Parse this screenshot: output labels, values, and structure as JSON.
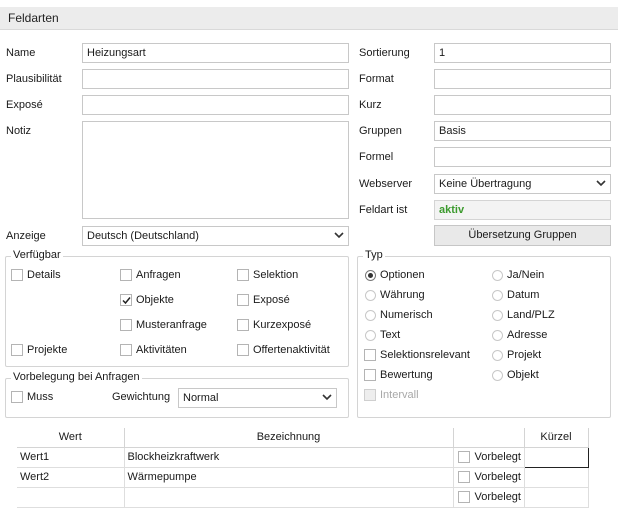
{
  "window": {
    "title": "Feldarten"
  },
  "left_fields": {
    "name": {
      "label": "Name",
      "value": "Heizungsart"
    },
    "plausibilitaet": {
      "label": "Plausibilität",
      "value": ""
    },
    "expose": {
      "label": "Exposé",
      "value": ""
    },
    "notiz": {
      "label": "Notiz",
      "value": ""
    },
    "anzeige": {
      "label": "Anzeige",
      "value": "Deutsch (Deutschland)"
    }
  },
  "right_fields": {
    "sortierung": {
      "label": "Sortierung",
      "value": "1"
    },
    "format": {
      "label": "Format",
      "value": ""
    },
    "kurz": {
      "label": "Kurz",
      "value": ""
    },
    "gruppen": {
      "label": "Gruppen",
      "value": "Basis"
    },
    "formel": {
      "label": "Formel",
      "value": ""
    },
    "webserver": {
      "label": "Webserver",
      "value": "Keine Übertragung"
    },
    "feldart_ist": {
      "label": "Feldart ist",
      "value": "aktiv"
    },
    "translate_button": "Übersetzung Gruppen"
  },
  "verfuegbar": {
    "title": "Verfügbar",
    "items": [
      {
        "label": "Details",
        "checked": false
      },
      {
        "label": "Anfragen",
        "checked": false
      },
      {
        "label": "Selektion",
        "checked": false
      },
      {
        "label": "Objekte",
        "checked": true
      },
      {
        "label": "Exposé",
        "checked": false
      },
      {
        "label": "Musteranfrage",
        "checked": false
      },
      {
        "label": "Kurzexposé",
        "checked": false
      },
      {
        "label": "Projekte",
        "checked": false
      },
      {
        "label": "Aktivitäten",
        "checked": false
      },
      {
        "label": "Offertenaktivität",
        "checked": false
      }
    ]
  },
  "vorbelegung": {
    "title": "Vorbelegung bei Anfragen",
    "muss_label": "Muss",
    "gewichtung_label": "Gewichtung",
    "gewichtung_value": "Normal"
  },
  "typ": {
    "title": "Typ",
    "radios": [
      {
        "label": "Optionen",
        "selected": true
      },
      {
        "label": "Ja/Nein",
        "selected": false
      },
      {
        "label": "Währung",
        "selected": false
      },
      {
        "label": "Datum",
        "selected": false
      },
      {
        "label": "Numerisch",
        "selected": false
      },
      {
        "label": "Land/PLZ",
        "selected": false
      },
      {
        "label": "Text",
        "selected": false
      },
      {
        "label": "Adresse",
        "selected": false
      },
      {
        "label": "Projekt",
        "selected": false
      },
      {
        "label": "Objekt",
        "selected": false
      }
    ],
    "checkboxes": [
      {
        "label": "Selektionsrelevant",
        "checked": false
      },
      {
        "label": "Bewertung",
        "checked": false
      },
      {
        "label": "Intervall",
        "checked": false,
        "disabled": true
      }
    ]
  },
  "table": {
    "headers": [
      "Wert",
      "Bezeichnung",
      "",
      "Kürzel"
    ],
    "rows": [
      {
        "wert": "Wert1",
        "bezeichnung": "Blockheizkraftwerk",
        "vorbelegt": "Vorbelegt",
        "kuerzel": ""
      },
      {
        "wert": "Wert2",
        "bezeichnung": "Wärmepumpe",
        "vorbelegt": "Vorbelegt",
        "kuerzel": ""
      },
      {
        "wert": "",
        "bezeichnung": "",
        "vorbelegt": "Vorbelegt",
        "kuerzel": ""
      }
    ]
  }
}
